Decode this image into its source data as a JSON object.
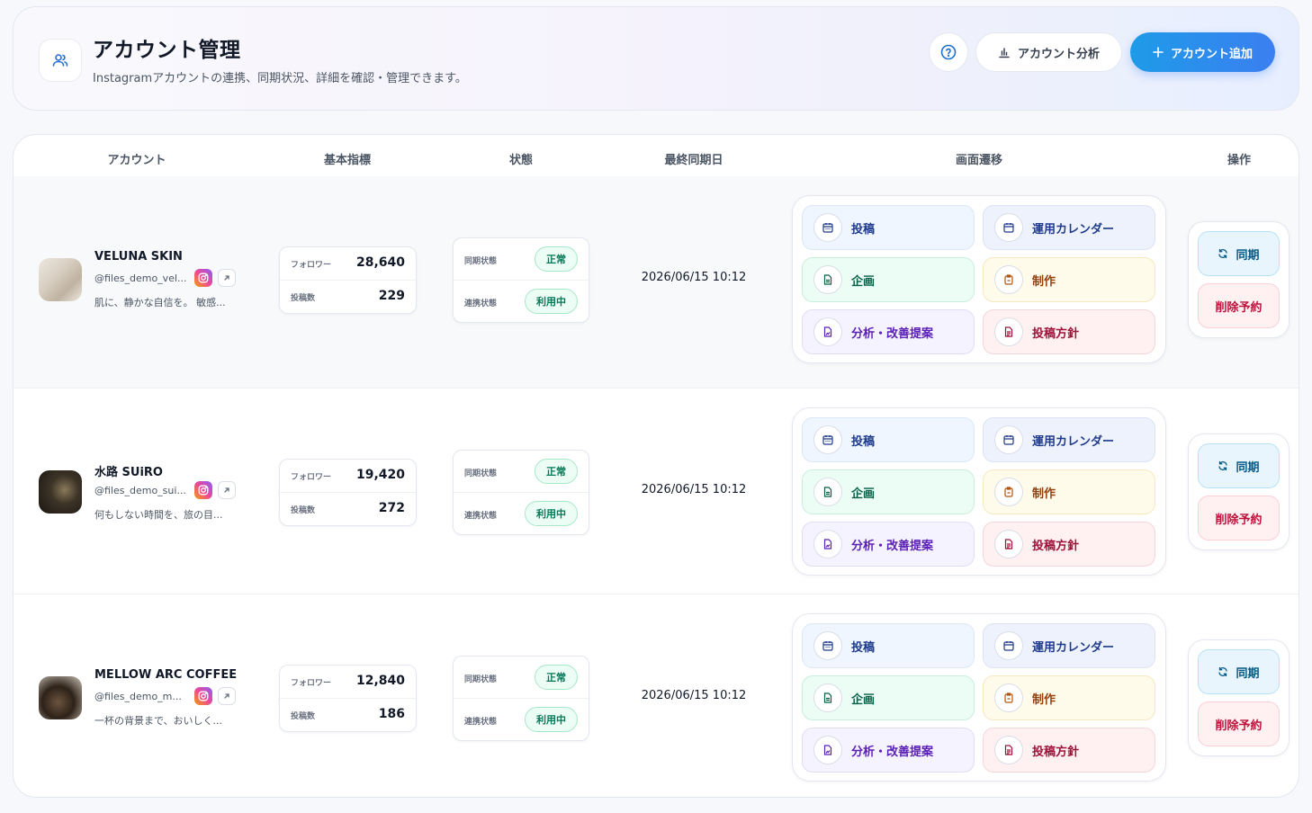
{
  "header": {
    "title": "アカウント管理",
    "subtitle": "Instagramアカウントの連携、同期状況、詳細を確認・管理できます。",
    "icon": "users-icon",
    "help_icon": "help-circle-icon",
    "analytics_label": "アカウント分析",
    "add_label": "アカウント追加",
    "accent_color": "#2a8ff0"
  },
  "table": {
    "headers": [
      "アカウント",
      "基本指標",
      "状態",
      "最終同期日",
      "画面遷移",
      "操作"
    ],
    "metric_labels": {
      "followers": "フォロワー",
      "posts": "投稿数"
    },
    "status_labels": {
      "sync": "同期状態",
      "link": "連携状態"
    },
    "nav_labels": [
      "投稿",
      "運用カレンダー",
      "企画",
      "制作",
      "分析・改善提案",
      "投稿方針"
    ],
    "ops_labels": {
      "sync": "同期",
      "delete": "削除予約"
    },
    "rows": [
      {
        "name": "VELUNA SKIN",
        "handle": "@files_demo_vel...",
        "description": "肌に、静かな自信を。 敏感...",
        "followers": "28,640",
        "posts": "229",
        "sync_status": "正常",
        "link_status": "利用中",
        "last_sync": "2026/06/15 10:12"
      },
      {
        "name": "水路 SUiRO",
        "handle": "@files_demo_sui...",
        "description": "何もしない時間を、旅の目...",
        "followers": "19,420",
        "posts": "272",
        "sync_status": "正常",
        "link_status": "利用中",
        "last_sync": "2026/06/15 10:12"
      },
      {
        "name": "MELLOW ARC COFFEE",
        "handle": "@files_demo_m...",
        "description": "一杯の背景まで、おいしく...",
        "followers": "12,840",
        "posts": "186",
        "sync_status": "正常",
        "link_status": "利用中",
        "last_sync": "2026/06/15 10:12"
      }
    ]
  }
}
